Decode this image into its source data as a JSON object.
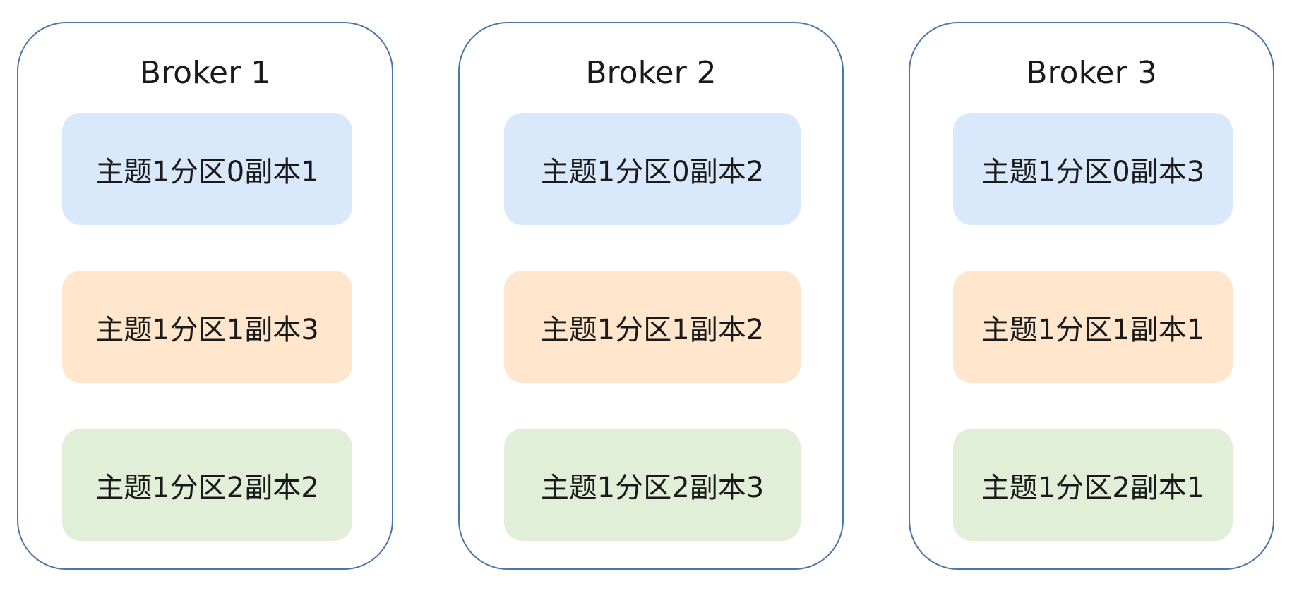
{
  "colors": {
    "broker_border": "#4a76a8",
    "partition_0": "#dae8fc",
    "partition_1": "#ffe6cc",
    "partition_2": "#e1eed8"
  },
  "brokers": [
    {
      "title": "Broker 1",
      "replicas": [
        "主题1分区0副本1",
        "主题1分区1副本3",
        "主题1分区2副本2"
      ]
    },
    {
      "title": "Broker 2",
      "replicas": [
        "主题1分区0副本2",
        "主题1分区1副本2",
        "主题1分区2副本3"
      ]
    },
    {
      "title": "Broker 3",
      "replicas": [
        "主题1分区0副本3",
        "主题1分区1副本1",
        "主题1分区2副本1"
      ]
    }
  ]
}
